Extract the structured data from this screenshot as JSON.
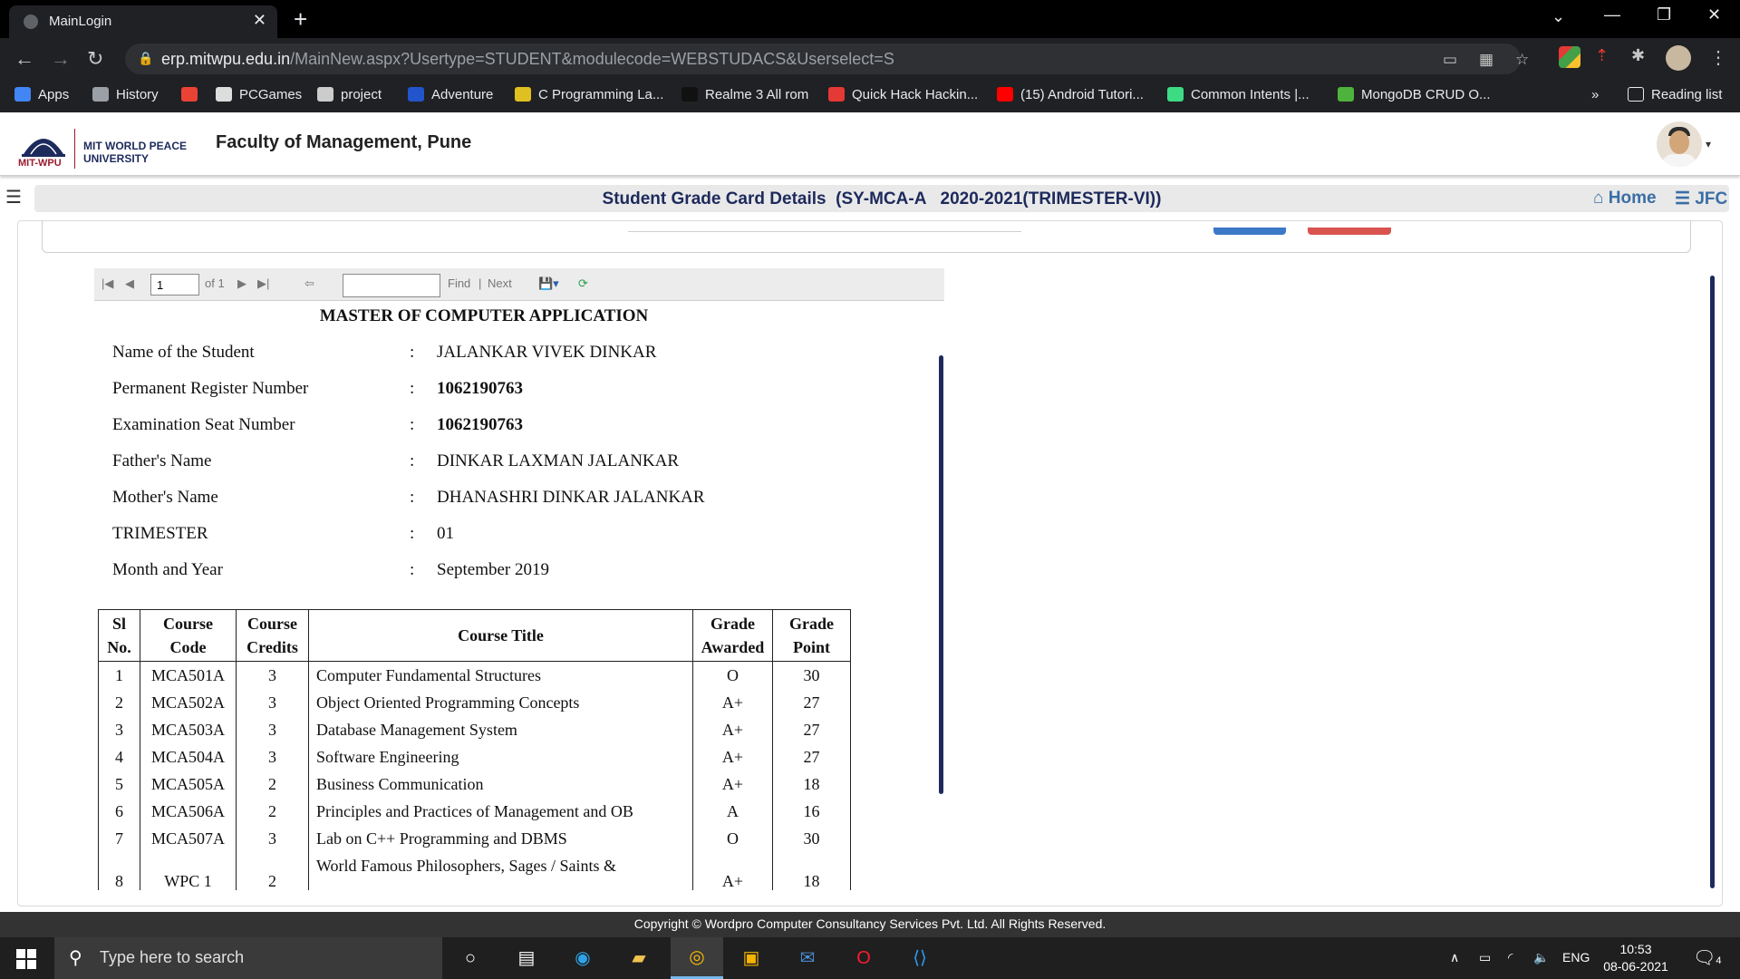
{
  "browser": {
    "tab_title": "MainLogin",
    "url_domain": "erp.mitwpu.edu.in",
    "url_path": "/MainNew.aspx?Usertype=STUDENT&modulecode=WEBSTUDACS&Userselect=S",
    "reading_list": "Reading list",
    "bookmarks": [
      {
        "label": "Apps",
        "icon": "apps-grid-icon",
        "color": "#4285f4"
      },
      {
        "label": "History",
        "icon": "history-icon",
        "color": "#9aa0a6"
      },
      {
        "label": "",
        "icon": "google-icon",
        "color": "#ea4335"
      },
      {
        "label": "PCGames",
        "icon": "pcgames-icon",
        "color": "#dddddd"
      },
      {
        "label": "project",
        "icon": "project-icon",
        "color": "#cccccc"
      },
      {
        "label": "Adventure",
        "icon": "adventure-icon",
        "color": "#2255cc"
      },
      {
        "label": "C Programming La...",
        "icon": "c-programming-icon",
        "color": "#e0c020"
      },
      {
        "label": "Realme 3 All rom",
        "icon": "realme-icon",
        "color": "#111111"
      },
      {
        "label": "Quick Hack Hackin...",
        "icon": "heart-icon",
        "color": "#e53935"
      },
      {
        "label": "(15) Android Tutori...",
        "icon": "youtube-icon",
        "color": "#ff0000"
      },
      {
        "label": "Common Intents |...",
        "icon": "android-icon",
        "color": "#3ddc84"
      },
      {
        "label": "MongoDB CRUD O...",
        "icon": "mongodb-icon",
        "color": "#4db33d"
      }
    ]
  },
  "site": {
    "logo_small": "Dr. Vishwanath Karad",
    "logo_line1": "MIT WORLD PEACE",
    "logo_line2": "UNIVERSITY",
    "logo_mark": "MIT-WPU",
    "faculty": "Faculty of Management, Pune",
    "page_title": "Student Grade Card Details  (SY-MCA-A   2020-2021(TRIMESTER-VI))",
    "home_label": "Home",
    "jfc_label": "JFC"
  },
  "report_toolbar": {
    "page_value": "1",
    "of_label": "of 1",
    "find_label": "Find",
    "separator": "|",
    "next_label": "Next"
  },
  "report": {
    "program": "MASTER OF COMPUTER APPLICATION",
    "fields": [
      {
        "label": "Name of the Student",
        "value": "JALANKAR VIVEK DINKAR"
      },
      {
        "label": "Permanent Register Number",
        "value": "1062190763"
      },
      {
        "label": "Examination Seat Number",
        "value": "1062190763"
      },
      {
        "label": "Father's Name",
        "value": "DINKAR LAXMAN JALANKAR"
      },
      {
        "label": "Mother's Name",
        "value": "DHANASHRI DINKAR JALANKAR"
      },
      {
        "label": "TRIMESTER",
        "value": "01"
      },
      {
        "label": "Month and Year",
        "value": "September 2019"
      }
    ],
    "colon": ":",
    "table_headers": {
      "sl_1": "Sl",
      "sl_2": "No.",
      "code_1": "Course",
      "code_2": "Code",
      "credits_1": "Course",
      "credits_2": "Credits",
      "title": "Course Title",
      "grade_1": "Grade",
      "grade_2": "Awarded",
      "point_1": "Grade",
      "point_2": "Point"
    },
    "courses": [
      {
        "sl": "1",
        "code": "MCA501A",
        "credits": "3",
        "title": "Computer Fundamental Structures",
        "grade": "O",
        "point": "30"
      },
      {
        "sl": "2",
        "code": "MCA502A",
        "credits": "3",
        "title": "Object Oriented Programming Concepts",
        "grade": "A+",
        "point": "27"
      },
      {
        "sl": "3",
        "code": "MCA503A",
        "credits": "3",
        "title": "Database Management System",
        "grade": "A+",
        "point": "27"
      },
      {
        "sl": "4",
        "code": "MCA504A",
        "credits": "3",
        "title": "Software Engineering",
        "grade": "A+",
        "point": "27"
      },
      {
        "sl": "5",
        "code": "MCA505A",
        "credits": "2",
        "title": "Business Communication",
        "grade": "A+",
        "point": "18"
      },
      {
        "sl": "6",
        "code": "MCA506A",
        "credits": "2",
        "title": "Principles and Practices of Management and OB",
        "grade": "A",
        "point": "16"
      },
      {
        "sl": "7",
        "code": "MCA507A",
        "credits": "3",
        "title": "Lab on C++ Programming and DBMS",
        "grade": "O",
        "point": "30"
      },
      {
        "sl": "8",
        "code": "WPC 1",
        "credits": "2",
        "title": "World Famous Philosophers, Sages / Saints &",
        "grade": "A+",
        "point": "18"
      }
    ]
  },
  "footer": {
    "copyright": "Copyright © Wordpro Computer Consultancy Services Pvt. Ltd. All Rights Reserved."
  },
  "taskbar": {
    "search_placeholder": "Type here to search",
    "language": "ENG",
    "time": "10:53",
    "date": "08-06-2021",
    "notification_count": "4"
  }
}
